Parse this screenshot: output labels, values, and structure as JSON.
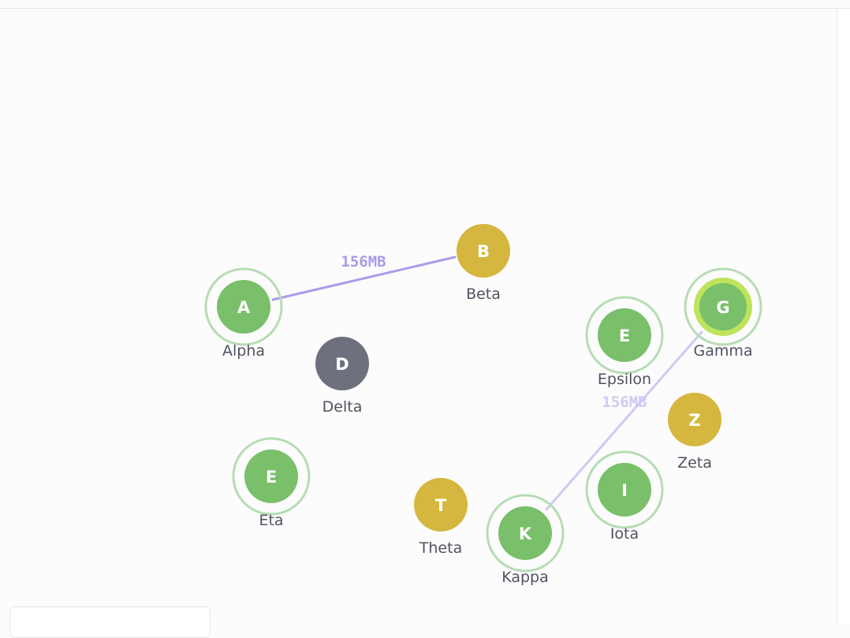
{
  "colors": {
    "online": "#7abf6a",
    "warning": "#d5b63e",
    "offline": "#6d717d",
    "ring": "#b6dcb4",
    "selected": "#bfe35b",
    "edge": "#a79cec",
    "edge_faded": "#cfc9f4",
    "label": "#525262"
  },
  "nodes": [
    {
      "id": "alpha",
      "letter": "A",
      "label": "Alpha",
      "status": "online",
      "ring": true,
      "selected": false
    },
    {
      "id": "beta",
      "letter": "B",
      "label": "Beta",
      "status": "warning",
      "ring": false,
      "selected": false
    },
    {
      "id": "gamma",
      "letter": "G",
      "label": "Gamma",
      "status": "online",
      "ring": true,
      "selected": true
    },
    {
      "id": "delta",
      "letter": "D",
      "label": "Delta",
      "status": "offline",
      "ring": false,
      "selected": false
    },
    {
      "id": "epsilon",
      "letter": "E",
      "label": "Epsilon",
      "status": "online",
      "ring": true,
      "selected": false
    },
    {
      "id": "zeta",
      "letter": "Z",
      "label": "Zeta",
      "status": "warning",
      "ring": false,
      "selected": false
    },
    {
      "id": "eta",
      "letter": "E",
      "label": "Eta",
      "status": "online",
      "ring": true,
      "selected": false
    },
    {
      "id": "theta",
      "letter": "T",
      "label": "Theta",
      "status": "warning",
      "ring": false,
      "selected": false
    },
    {
      "id": "iota",
      "letter": "I",
      "label": "Iota",
      "status": "online",
      "ring": true,
      "selected": false
    },
    {
      "id": "kappa",
      "letter": "K",
      "label": "Kappa",
      "status": "online",
      "ring": true,
      "selected": false
    }
  ],
  "edges": [
    {
      "from": "alpha",
      "to": "beta",
      "label": "156MB",
      "faded": false
    },
    {
      "from": "gamma",
      "to": "kappa",
      "label": "156MB",
      "faded": true
    }
  ]
}
